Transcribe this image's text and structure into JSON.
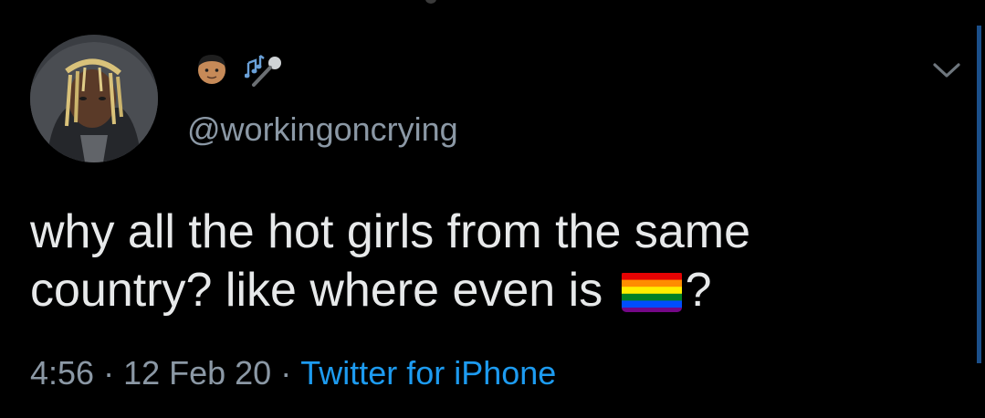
{
  "tweet": {
    "display_name_icons": [
      "man-emoji-icon",
      "musical-notes-icon",
      "microphone-icon"
    ],
    "handle": "@workingoncrying",
    "text_line1": "why all the hot girls from the same",
    "text_line2_before_flag": "country? like where even is ",
    "text_line2_after_flag": "?",
    "flag_icon": "rainbow-flag-icon",
    "time": "4:56",
    "date": "12 Feb 20",
    "separator": "·",
    "source": "Twitter for iPhone"
  },
  "colors": {
    "background": "#000000",
    "text": "#e7e9ea",
    "secondary": "#8b98a5",
    "link": "#1d9bf0"
  }
}
